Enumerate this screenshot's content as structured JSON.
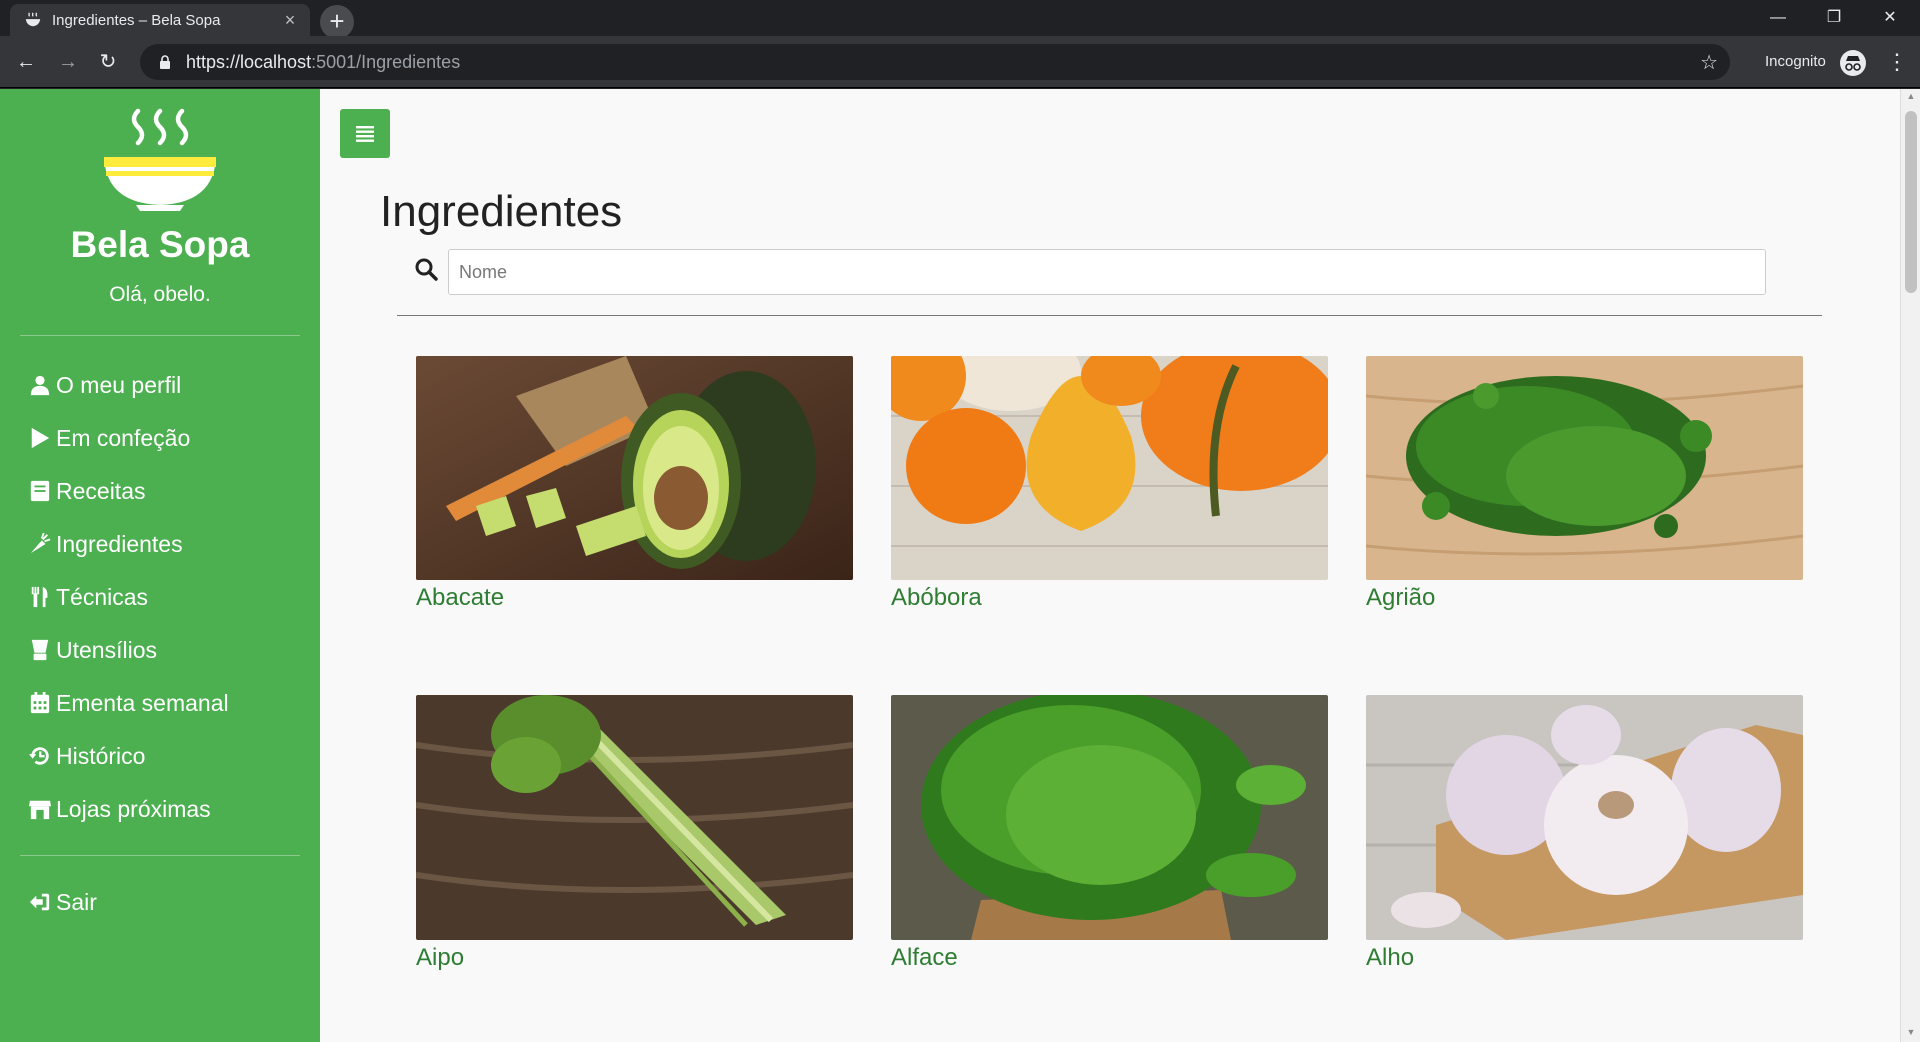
{
  "browser": {
    "tab_title": "Ingredientes – Bela Sopa",
    "tab_close": "×",
    "new_tab": "+",
    "url_main": "https://localhost",
    "url_rest": ":5001/Ingredientes",
    "incognito_label": "Incognito",
    "window": {
      "minimize": "—",
      "restore": "❐",
      "close": "✕"
    },
    "nav": {
      "back": "←",
      "forward": "→",
      "reload": "↻"
    },
    "star": "☆",
    "menu": "⋮"
  },
  "sidebar": {
    "brand": "Bela Sopa",
    "greeting": "Olá, obelo.",
    "items": [
      {
        "label": "O meu perfil",
        "icon": "user-icon"
      },
      {
        "label": "Em confeção",
        "icon": "play-icon"
      },
      {
        "label": "Receitas",
        "icon": "book-icon"
      },
      {
        "label": "Ingredientes",
        "icon": "carrot-icon"
      },
      {
        "label": "Técnicas",
        "icon": "utensils-icon"
      },
      {
        "label": "Utensílios",
        "icon": "blender-icon"
      },
      {
        "label": "Ementa semanal",
        "icon": "calendar-icon"
      },
      {
        "label": "Histórico",
        "icon": "history-icon"
      },
      {
        "label": "Lojas próximas",
        "icon": "store-icon"
      }
    ],
    "logout": {
      "label": "Sair",
      "icon": "sign-out-icon"
    }
  },
  "main": {
    "title": "Ingredientes",
    "search": {
      "placeholder": "Nome",
      "value": ""
    },
    "ingredients": [
      {
        "name": "Abacate"
      },
      {
        "name": "Abóbora"
      },
      {
        "name": "Agrião"
      },
      {
        "name": "Aipo"
      },
      {
        "name": "Alface"
      },
      {
        "name": "Alho"
      }
    ]
  },
  "colors": {
    "brand_green": "#4caf50",
    "link_green": "#2e7d32",
    "chrome_dark": "#202124",
    "chrome_toolbar": "#35363a"
  }
}
